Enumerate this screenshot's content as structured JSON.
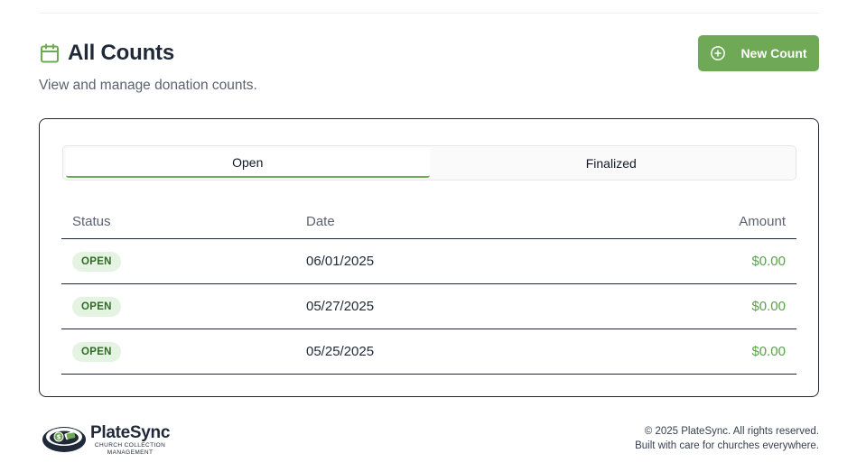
{
  "header": {
    "title": "All Counts",
    "subtitle": "View and manage donation counts.",
    "new_count_label": "New Count"
  },
  "tabs": [
    {
      "label": "Open",
      "active": true
    },
    {
      "label": "Finalized",
      "active": false
    }
  ],
  "table": {
    "columns": [
      "Status",
      "Date",
      "Amount"
    ],
    "rows": [
      {
        "status": "OPEN",
        "date": "06/01/2025",
        "amount": "$0.00"
      },
      {
        "status": "OPEN",
        "date": "05/27/2025",
        "amount": "$0.00"
      },
      {
        "status": "OPEN",
        "date": "05/25/2025",
        "amount": "$0.00"
      }
    ]
  },
  "footer": {
    "brand_name": "PlateSync",
    "brand_tagline_1": "CHURCH COLLECTION",
    "brand_tagline_2": "MANAGEMENT",
    "copyright": "© 2025 PlateSync. All rights reserved.",
    "tagline": "Built with care for churches everywhere."
  },
  "colors": {
    "accent": "#6fa955",
    "badge_bg": "#e5f4e2",
    "badge_text": "#2f6b25",
    "amount": "#5aa24a"
  },
  "icons": {
    "title_icon": "calendar-icon",
    "button_icon": "plus-circle-icon",
    "logo_icon": "collection-plate-icon"
  }
}
